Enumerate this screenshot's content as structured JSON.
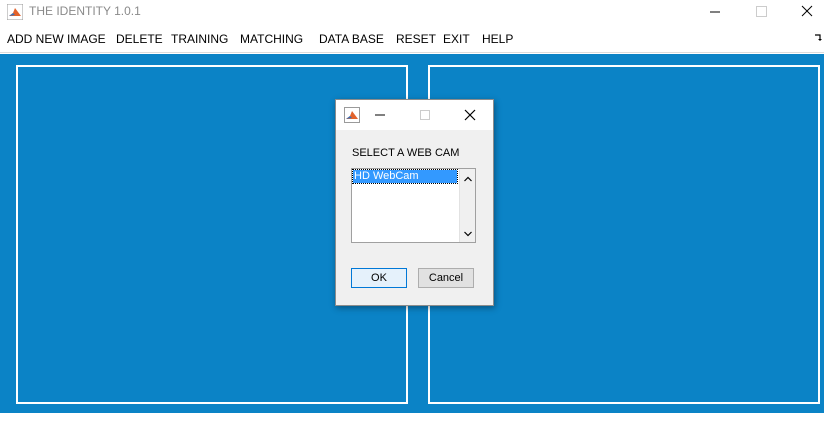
{
  "window": {
    "title": "THE IDENTITY 1.0.1"
  },
  "menu": {
    "items": [
      "ADD NEW IMAGE",
      "DELETE",
      "TRAINING",
      "MATCHING",
      "DATA BASE",
      "RESET",
      "EXIT",
      "HELP"
    ]
  },
  "colors": {
    "canvas_bg": "#0b83c6",
    "axes_border": "#ffffff",
    "selection": "#3399ff"
  },
  "dialog": {
    "prompt": "SELECT A WEB CAM",
    "list": {
      "options": [
        "HD WebCam"
      ],
      "selected": "HD WebCam"
    },
    "ok_label": "OK",
    "cancel_label": "Cancel"
  },
  "icons": {
    "app": "matlab-icon",
    "minimize": "minimize-icon",
    "maximize": "maximize-icon",
    "close": "close-icon",
    "scroll_up": "chevron-up-icon",
    "scroll_down": "chevron-down-icon"
  }
}
